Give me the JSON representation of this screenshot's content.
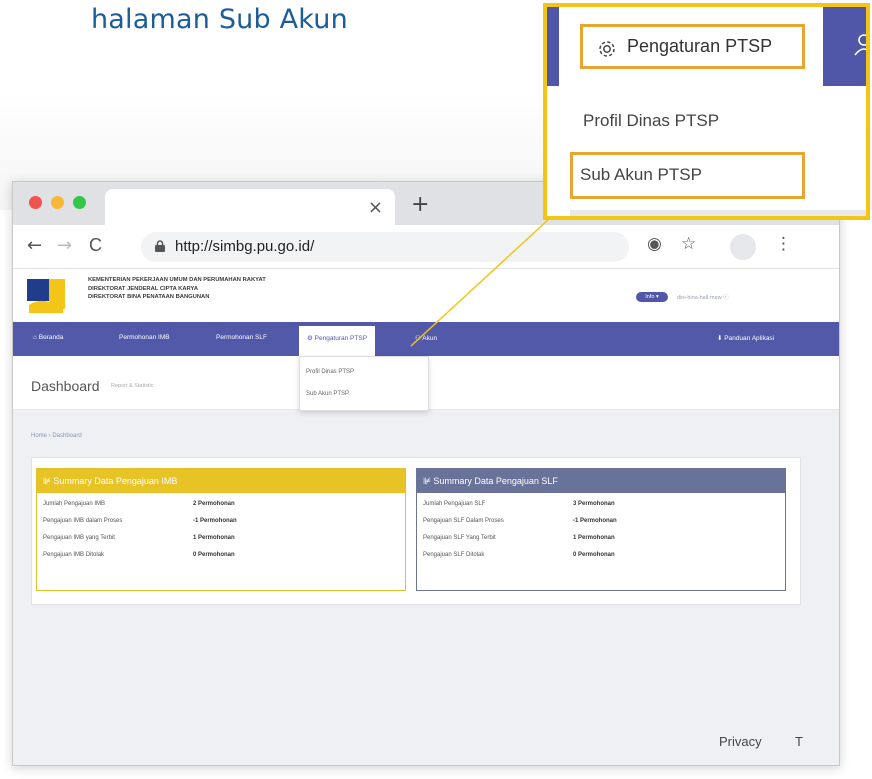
{
  "heading": "halaman Sub Akun",
  "browser": {
    "tab_close": "×",
    "new_tab": "+",
    "back": "←",
    "forward": "→",
    "reload": "C",
    "url": "http://simbg.pu.go.id/",
    "ext_icon": "◉",
    "star_icon": "☆",
    "menu_icon": "⋮"
  },
  "site": {
    "ministry_lines": [
      "KEMENTERIAN PEKERJAAN UMUM DAN PERUMAHAN RAKYAT",
      "DIREKTORAT JENDERAL CIPTA KARYA",
      "DIREKTORAT BINA PENATAAN BANGUNAN"
    ],
    "info_badge": "Info ▾",
    "user_text": "dini-bina-hall-mew ⓘ",
    "nav": {
      "home": "⌂ Beranda",
      "imb": "Permohonan IMB",
      "slf": "Permohonan SLF",
      "settings": "⚙ Pengaturan PTSP",
      "account": "⚇ Akun",
      "guide": "⬇ Panduan Aplikasi"
    },
    "dropdown": [
      "Profil Dinas PTSP",
      "Sub Akun PTSP"
    ],
    "dashboard_title": "Dashboard",
    "dashboard_sub": "Report & Statistic",
    "breadcrumb": "Home › Dashboard",
    "imb_card": {
      "title": "⊯ Summary Data Pengajuan IMB",
      "rows": [
        {
          "label": "Jumlah Pengajuan IMB",
          "value": "2 Permohonan"
        },
        {
          "label": "Pengajuan IMB dalam Proses",
          "value": "-1 Permohonan"
        },
        {
          "label": "Pengajuan IMB yang Terbit",
          "value": "1 Permohonan"
        },
        {
          "label": "Pengajuan IMB Ditolak",
          "value": "0 Permohonan"
        }
      ]
    },
    "slf_card": {
      "title": "⊯ Summary Data Pengajuan SLF",
      "rows": [
        {
          "label": "Jumlah Pengajuan SLF",
          "value": "3 Permohonan"
        },
        {
          "label": "Pengajuan SLF Dalam Proses",
          "value": "-1 Permohonan"
        },
        {
          "label": "Pengajuan SLF Yang Terbit",
          "value": "1 Permohonan"
        },
        {
          "label": "Pengajuan SLF Ditolak",
          "value": "0 Permohonan"
        }
      ]
    },
    "footer_privacy": "Privacy",
    "footer_terms": "T"
  },
  "callout": {
    "settings": "Pengaturan PTSP",
    "items": [
      "Profil Dinas PTSP",
      "Sub Akun PTSP"
    ]
  },
  "colors": {
    "accent_blue": "#5259a9",
    "highlight_yellow": "#f3c516",
    "callout_orange": "#e7a531",
    "imb_yellow": "#e8c326",
    "slf_slate": "#69739a",
    "heading_blue": "#1b5d9a"
  }
}
